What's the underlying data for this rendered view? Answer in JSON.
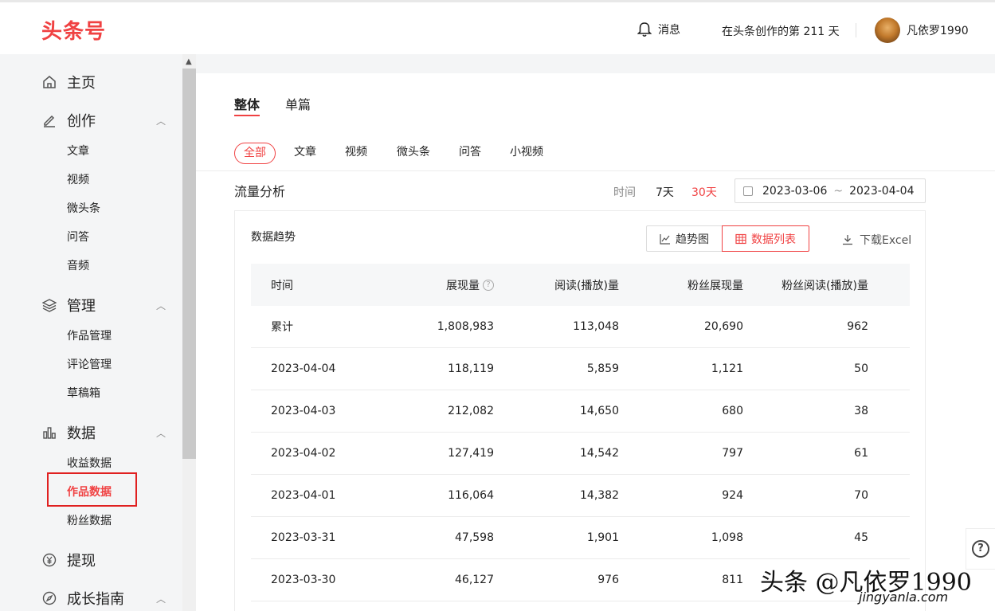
{
  "header": {
    "logo": "头条号",
    "messages_label": "消息",
    "days_text": "在头条创作的第 211 天",
    "username": "凡依罗1990"
  },
  "sidebar": {
    "home": "主页",
    "create": {
      "label": "创作",
      "items": [
        "文章",
        "视频",
        "微头条",
        "问答",
        "音频"
      ]
    },
    "manage": {
      "label": "管理",
      "items": [
        "作品管理",
        "评论管理",
        "草稿箱"
      ]
    },
    "data": {
      "label": "数据",
      "items": [
        "收益数据",
        "作品数据",
        "粉丝数据"
      ]
    },
    "withdraw": "提现",
    "growth": "成长指南"
  },
  "main": {
    "tabs": [
      "整体",
      "单篇"
    ],
    "filters": [
      "全部",
      "文章",
      "视频",
      "微头条",
      "问答",
      "小视频"
    ],
    "section_title": "流量分析",
    "time_label": "时间",
    "ranges": [
      "7天",
      "30天"
    ],
    "date_start": "2023-03-06",
    "date_sep": "~",
    "date_end": "2023-04-04",
    "panel_title": "数据趋势",
    "trend_button": "趋势图",
    "list_button": "数据列表",
    "download": "下载Excel"
  },
  "table": {
    "headers": [
      "时间",
      "展现量",
      "阅读(播放)量",
      "粉丝展现量",
      "粉丝阅读(播放)量"
    ],
    "rows": [
      [
        "累计",
        "1,808,983",
        "113,048",
        "20,690",
        "962"
      ],
      [
        "2023-04-04",
        "118,119",
        "5,859",
        "1,121",
        "50"
      ],
      [
        "2023-04-03",
        "212,082",
        "14,650",
        "680",
        "38"
      ],
      [
        "2023-04-02",
        "127,419",
        "14,542",
        "797",
        "61"
      ],
      [
        "2023-04-01",
        "116,064",
        "14,382",
        "924",
        "70"
      ],
      [
        "2023-03-31",
        "47,598",
        "1,901",
        "1,098",
        "45"
      ],
      [
        "2023-03-30",
        "46,127",
        "976",
        "811",
        ""
      ]
    ]
  },
  "watermark": {
    "text": "头条 @凡依罗1990",
    "url": "jingyanla.com"
  },
  "colors": {
    "accent": "#f04142",
    "highlight_box": "#e02020"
  }
}
